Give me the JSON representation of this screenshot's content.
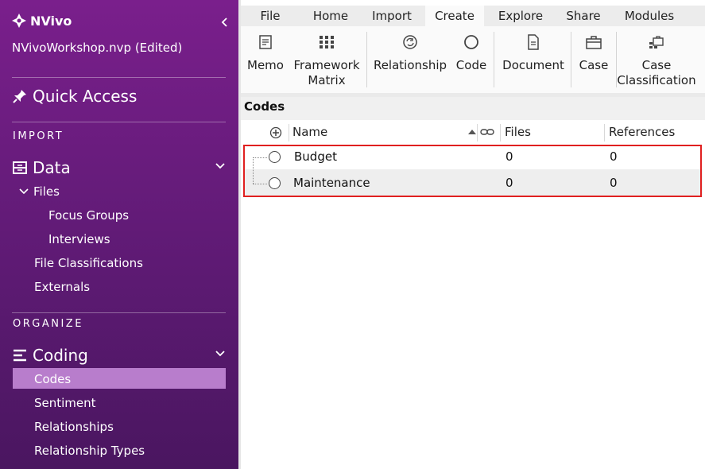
{
  "app": {
    "name": "NVivo",
    "project": "NVivoWorkshop.nvp (Edited)"
  },
  "sidebar": {
    "quick_access": "Quick Access",
    "sections": {
      "import": "IMPORT",
      "organize": "ORGANIZE"
    },
    "data": {
      "label": "Data",
      "files": "Files",
      "focus_groups": "Focus Groups",
      "interviews": "Interviews",
      "file_classifications": "File Classifications",
      "externals": "Externals"
    },
    "coding": {
      "label": "Coding",
      "codes": "Codes",
      "sentiment": "Sentiment",
      "relationships": "Relationships",
      "relationship_types": "Relationship Types"
    }
  },
  "ribbon": {
    "tabs": [
      "File",
      "Home",
      "Import",
      "Create",
      "Explore",
      "Share",
      "Modules"
    ],
    "active_tab": "Create",
    "tools": {
      "memo": "Memo",
      "framework_1": "Framework",
      "framework_2": "Matrix",
      "relationship": "Relationship",
      "code": "Code",
      "document": "Document",
      "case": "Case",
      "case_classification_1": "Case",
      "case_classification_2": "Classification"
    }
  },
  "codes_panel": {
    "title": "Codes",
    "columns": {
      "name": "Name",
      "files": "Files",
      "references": "References"
    },
    "rows": [
      {
        "name": "Budget",
        "files": "0",
        "references": "0"
      },
      {
        "name": "Maintenance",
        "files": "0",
        "references": "0"
      }
    ]
  },
  "colors": {
    "sidebar": "#7a1f8c",
    "selected": "#b87dcc",
    "highlight": "#e02020"
  }
}
